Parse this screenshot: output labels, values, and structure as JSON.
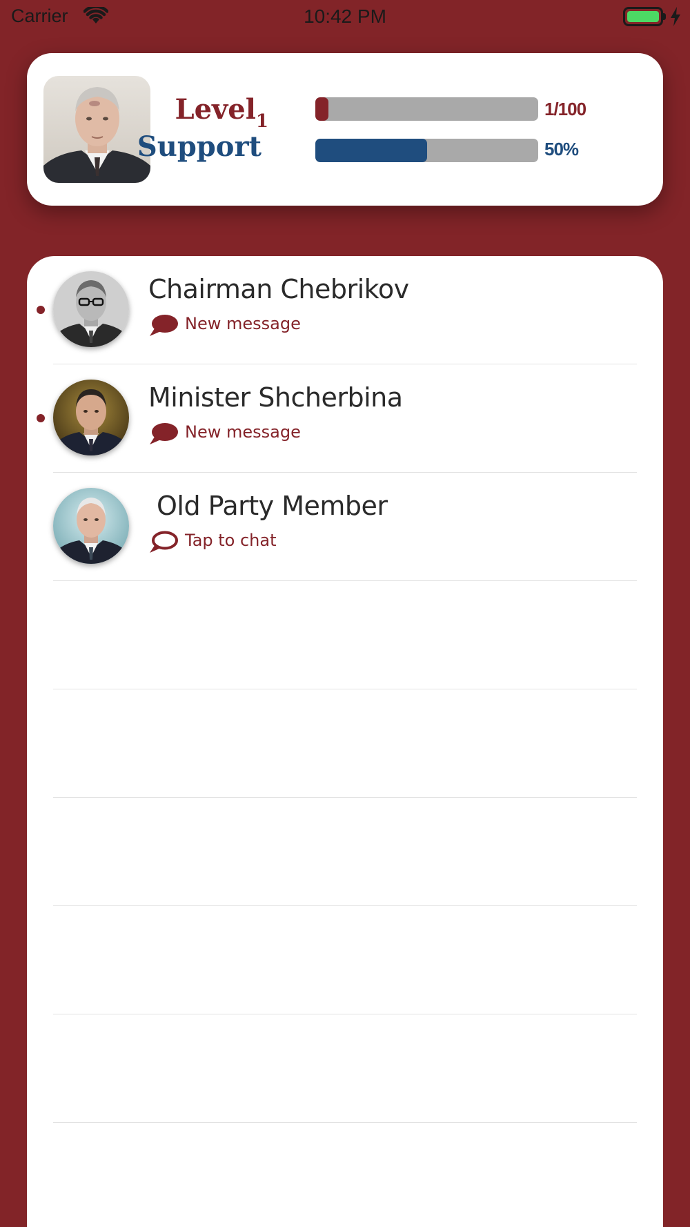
{
  "status_bar": {
    "carrier": "Carrier",
    "time": "10:42 PM"
  },
  "header": {
    "level_label": "Level",
    "level_number": "1",
    "support_label": "Support",
    "level_value": "1/100",
    "level_progress": 0.01,
    "support_value": "50%",
    "support_progress": 0.5
  },
  "contacts": [
    {
      "name": "Chairman Chebrikov",
      "status": "New message",
      "unread": true
    },
    {
      "name": "Minister Shcherbina",
      "status": "New message",
      "unread": true
    },
    {
      "name": "Old Party Member",
      "status": "Tap to chat",
      "unread": false
    }
  ],
  "colors": {
    "background": "#822428",
    "accent_red": "#842329",
    "accent_blue": "#1f4d7e",
    "track_gray": "#a9a9a9"
  },
  "icons": {
    "wifi": "wifi-icon",
    "battery": "battery-icon",
    "charging": "charging-bolt-icon",
    "message_filled": "chat-bubble-filled-icon",
    "message_outline": "chat-bubble-outline-icon"
  }
}
